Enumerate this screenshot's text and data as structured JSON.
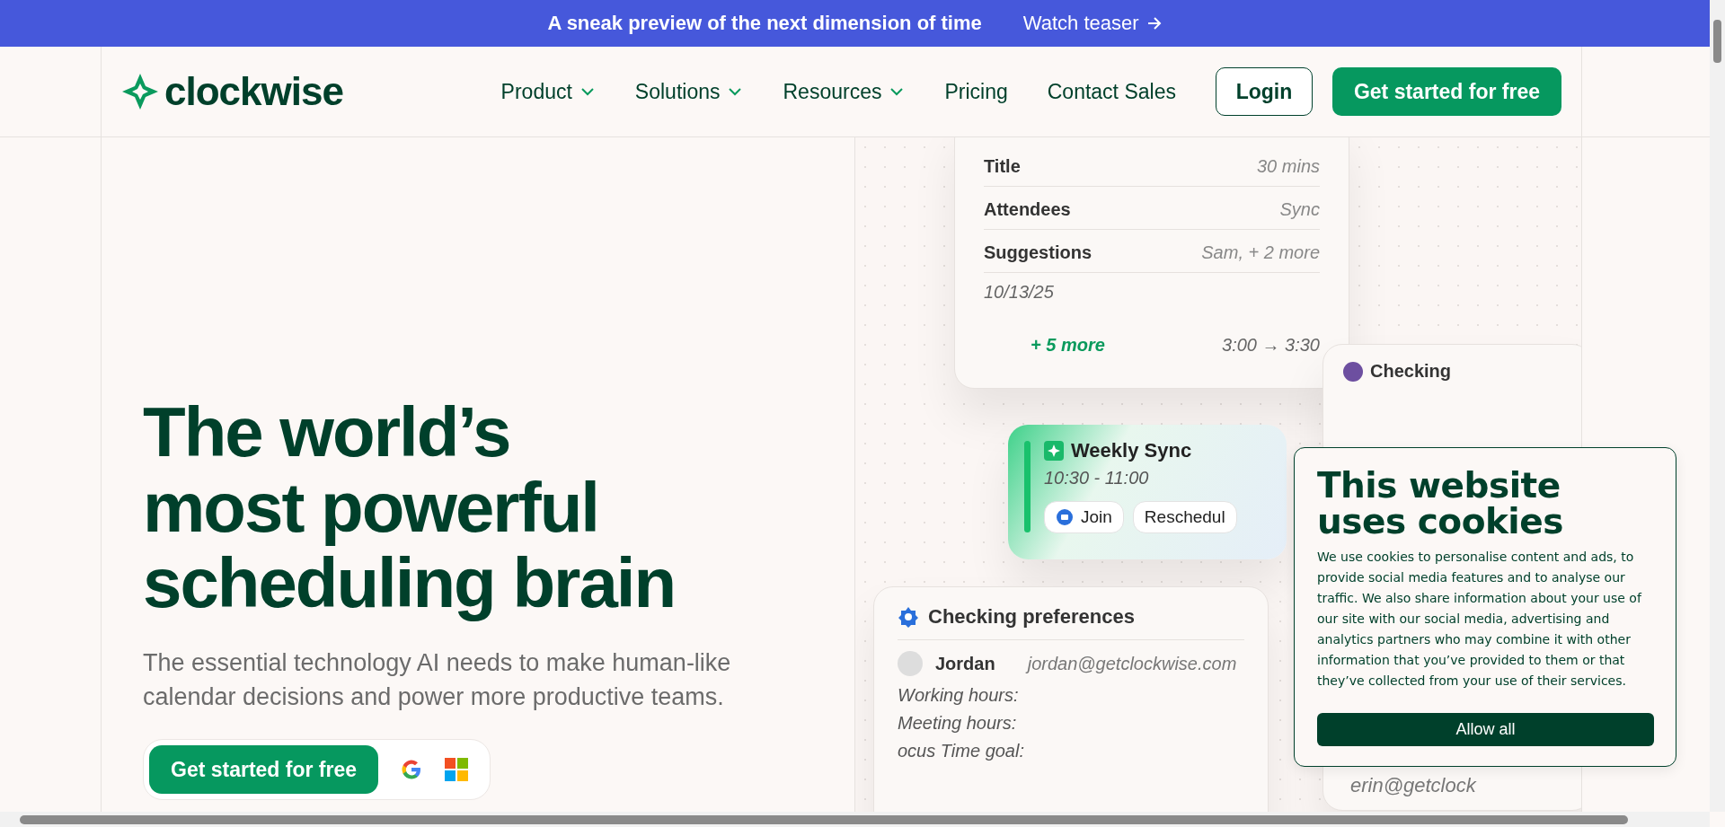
{
  "banner": {
    "text": "A sneak preview of the next dimension of time",
    "link": "Watch teaser"
  },
  "nav": {
    "logo": "clockwise",
    "items": [
      {
        "label": "Product",
        "dropdown": true
      },
      {
        "label": "Solutions",
        "dropdown": true
      },
      {
        "label": "Resources",
        "dropdown": true
      },
      {
        "label": "Pricing",
        "dropdown": false
      },
      {
        "label": "Contact Sales",
        "dropdown": false
      }
    ],
    "login": "Login",
    "cta": "Get started for free"
  },
  "hero": {
    "headline": [
      "The world’s",
      "most powerful",
      "scheduling brain"
    ],
    "subtitle": "The essential technology AI needs to make human-like calendar decisions and power more productive teams.",
    "cta": "Get started for free"
  },
  "mockup": {
    "details_card": {
      "rows": [
        {
          "label": "Title",
          "value": "30 mins"
        },
        {
          "label": "Attendees",
          "value": "Sync"
        },
        {
          "label": "Suggestions",
          "value": "Sam, + 2 more"
        }
      ],
      "date": "10/13/25",
      "more": "+ 5 more",
      "time": "3:00 → 3:30"
    },
    "event_card": {
      "title": "Weekly Sync",
      "time": "10:30 - 11:00",
      "buttons": [
        "Join",
        "Reschedul"
      ]
    },
    "prefs_card": {
      "title": "Checking preferences",
      "user": "Jordan",
      "email": "jordan@getclockwise.com",
      "fields": [
        "Working hours:",
        "Meeting hours:",
        "ocus Time goal:"
      ]
    },
    "side_card": {
      "title": "Checking",
      "email": "erin@getclock"
    }
  },
  "cookie_banner": {
    "title": "This website uses cookies",
    "body": "We use cookies to personalise content and ads, to provide social media features and to analyse our traffic. We also share information about your use of our site with our social media, advertising and analytics partners who may combine it with other information that you’ve provided to them or that they’ve collected from your use of their services.",
    "button": "Allow all"
  }
}
